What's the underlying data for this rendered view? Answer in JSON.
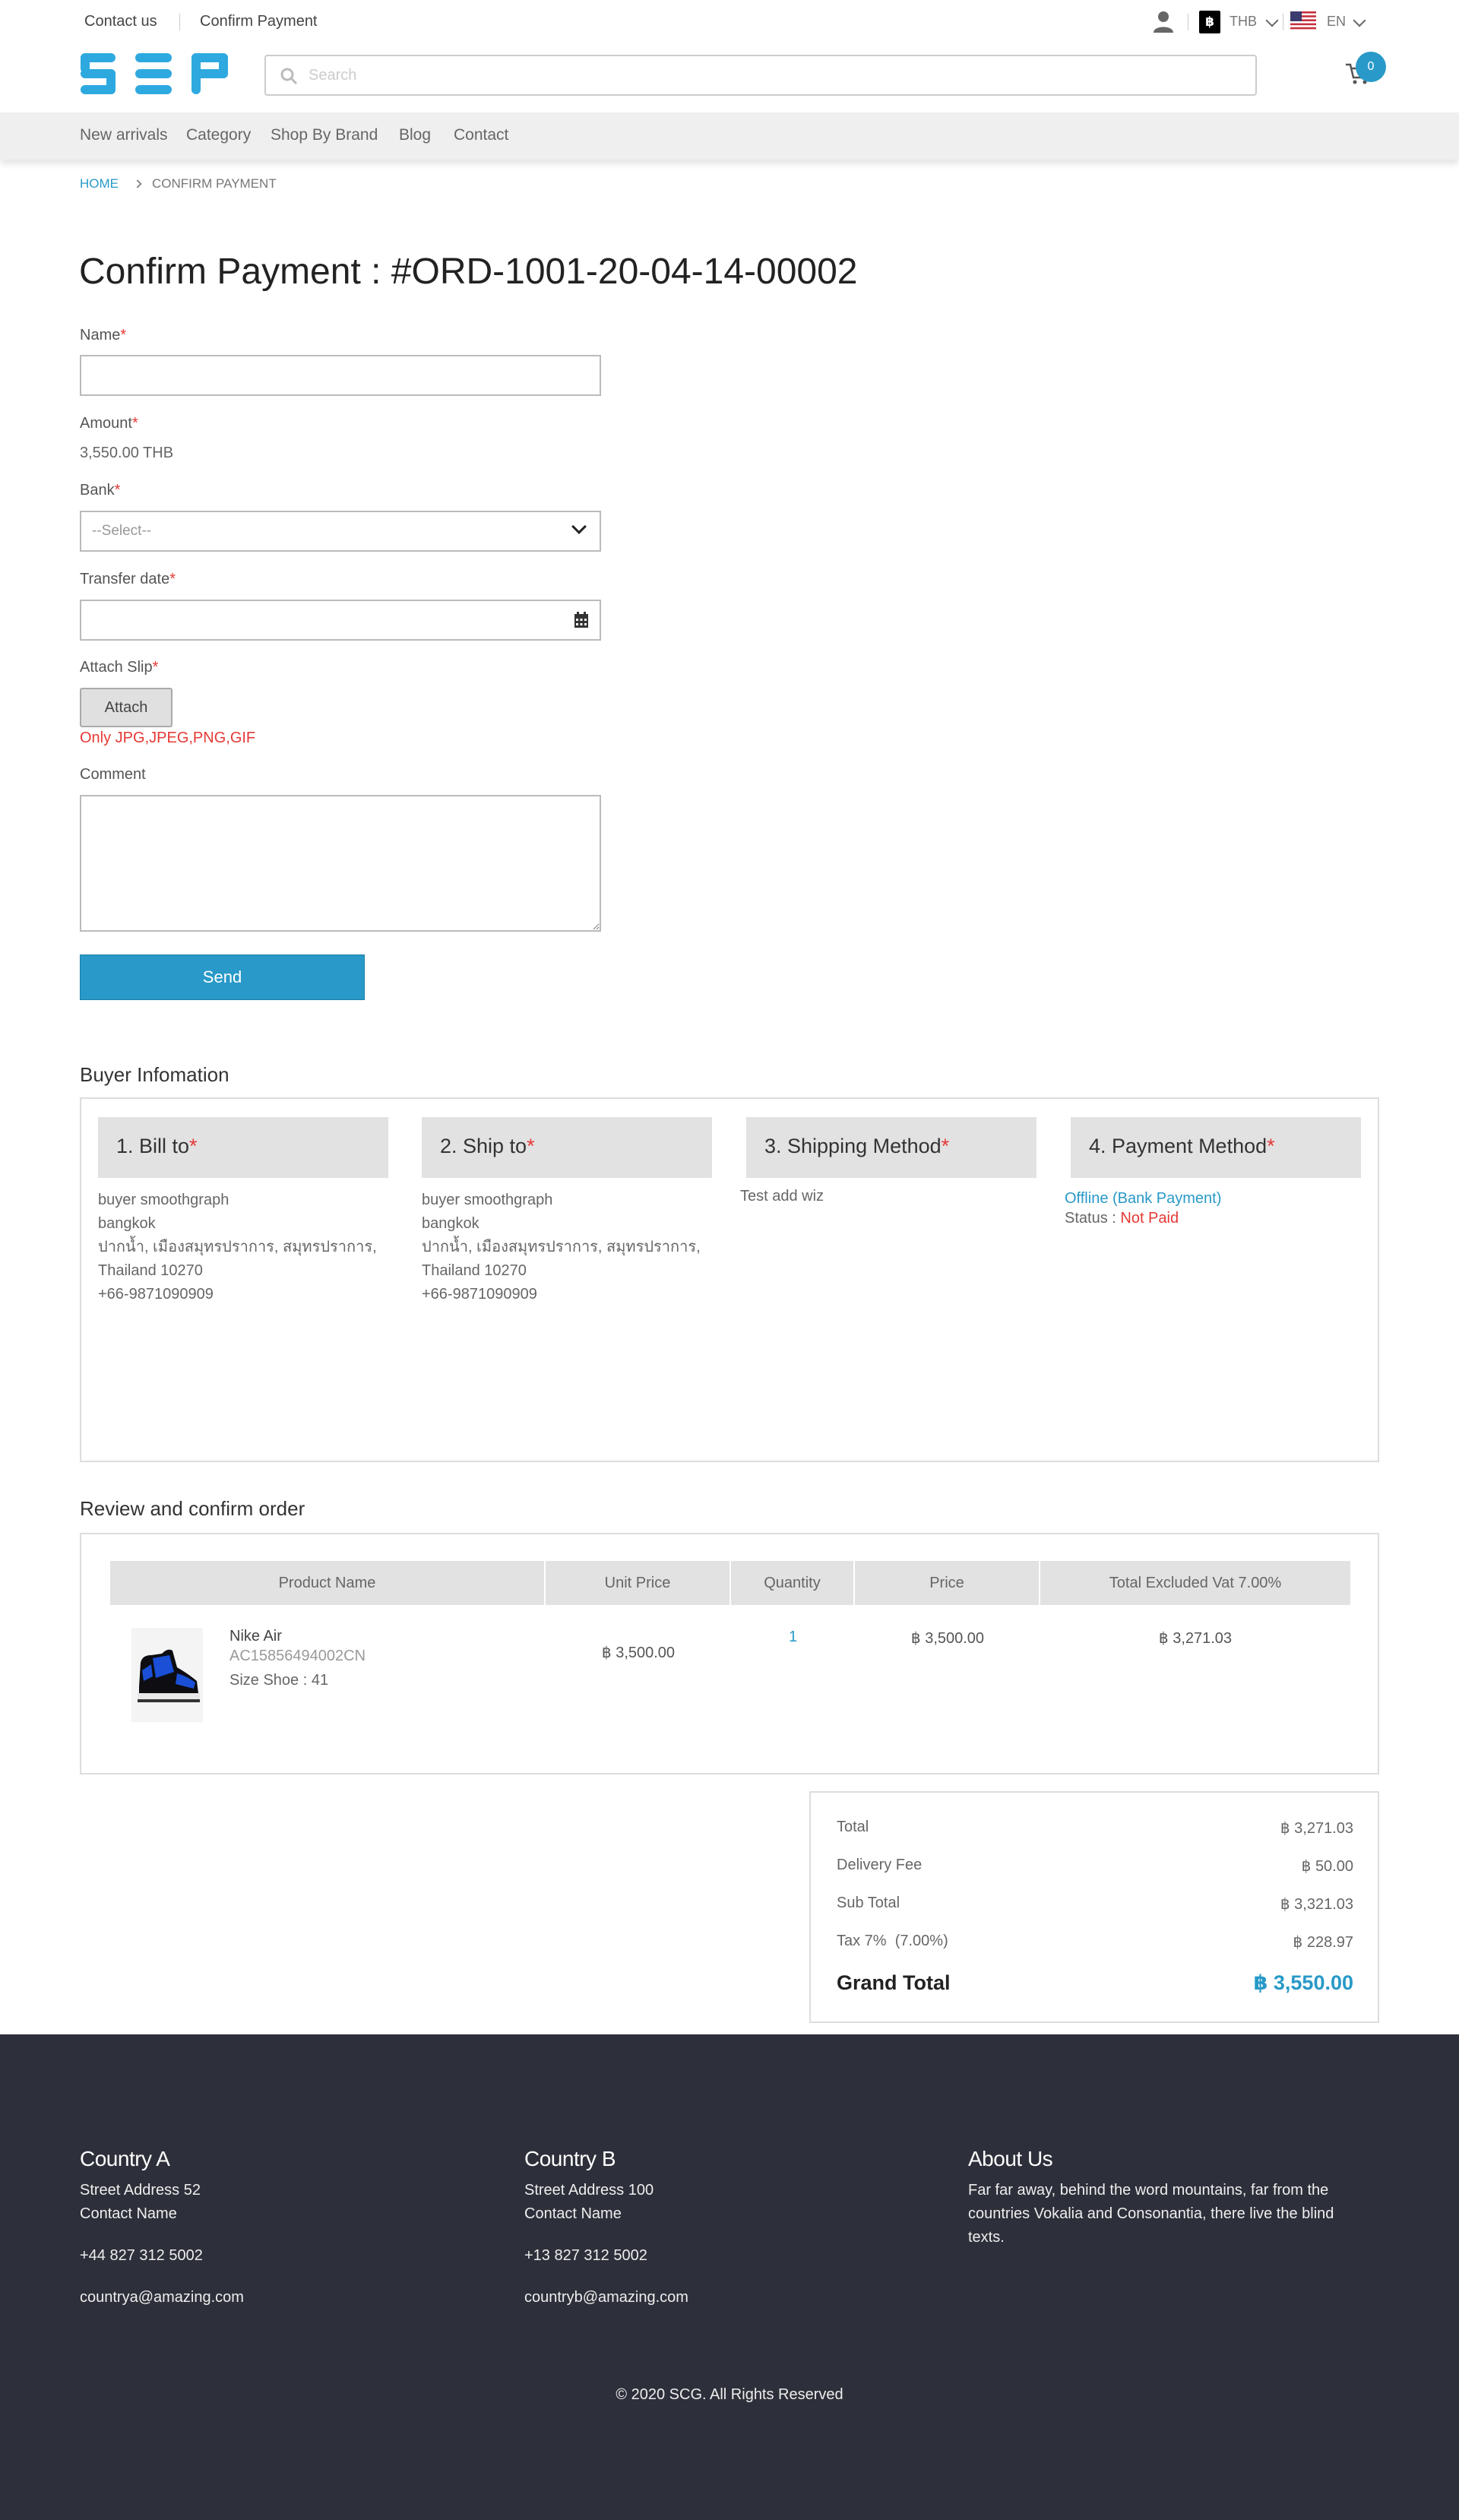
{
  "topbar": {
    "contact_us": "Contact us",
    "confirm_payment": "Confirm Payment",
    "currency_symbol": "฿",
    "currency": "THB",
    "language": "EN",
    "user_icon": "user-icon",
    "flag_icon": "us-flag-icon"
  },
  "header": {
    "logo_text": "SEP",
    "search_placeholder": "Search",
    "cart_count": "0",
    "accent_color": "#2899c8"
  },
  "nav": {
    "items": [
      "New arrivals",
      "Category",
      "Shop By Brand",
      "Blog",
      "Contact"
    ]
  },
  "breadcrumb": {
    "home": "HOME",
    "current": "CONFIRM PAYMENT"
  },
  "page": {
    "title": "Confirm Payment : #ORD-1001-20-04-14-00002"
  },
  "form": {
    "name_label": "Name",
    "amount_label": "Amount",
    "amount_value": "3,550.00 THB",
    "bank_label": "Bank",
    "bank_selected": "--Select--",
    "transfer_date_label": "Transfer date",
    "attach_slip_label": "Attach Slip",
    "attach_button": "Attach",
    "attach_hint": "Only JPG,JPEG,PNG,GIF",
    "comment_label": "Comment",
    "send_button": "Send",
    "required_mark": "*"
  },
  "buyer": {
    "section_title": "Buyer Infomation",
    "bill_to": {
      "heading": "1. Bill to",
      "lines": [
        "buyer smoothgraph",
        "bangkok",
        "ปากน้ำ, เมืองสมุทรปราการ, สมุทรปราการ,",
        "Thailand 10270",
        "+66-9871090909"
      ]
    },
    "ship_to": {
      "heading": "2. Ship to",
      "lines": [
        "buyer smoothgraph",
        "bangkok",
        "ปากน้ำ, เมืองสมุทรปราการ, สมุทรปราการ,",
        "Thailand 10270",
        "+66-9871090909"
      ]
    },
    "shipping_method": {
      "heading": "3. Shipping Method",
      "value": "Test add wiz"
    },
    "payment_method": {
      "heading": "4. Payment Method",
      "value": "Offline (Bank Payment)",
      "status_label": "Status :",
      "status_value": "Not Paid"
    }
  },
  "review": {
    "section_title": "Review and confirm order",
    "columns": [
      "Product Name",
      "Unit Price",
      "Quantity",
      "Price",
      "Total Excluded Vat 7.00%"
    ],
    "rows": [
      {
        "name": "Nike Air",
        "sku": "AC15856494002CN",
        "size": "Size Shoe : 41",
        "unit_price": "฿ 3,500.00",
        "quantity": "1",
        "price": "฿ 3,500.00",
        "total_ex_vat": "฿ 3,271.03"
      }
    ]
  },
  "totals": {
    "rows": [
      {
        "label": "Total",
        "value": "฿ 3,271.03"
      },
      {
        "label": "Delivery Fee",
        "value": "฿ 50.00"
      },
      {
        "label": "Sub Total",
        "value": "฿ 3,321.03"
      },
      {
        "label": "Tax 7%  (7.00%)",
        "value": "฿ 228.97"
      }
    ],
    "grand_label": "Grand Total",
    "grand_value": "฿ 3,550.00"
  },
  "footer": {
    "country_a": {
      "title": "Country A",
      "address": "Street Address 52",
      "contact": "Contact Name",
      "phone": "+44 827 312 5002",
      "email": "countrya@amazing.com"
    },
    "country_b": {
      "title": "Country B",
      "address": "Street Address 100",
      "contact": "Contact Name",
      "phone": "+13 827 312 5002",
      "email": "countryb@amazing.com"
    },
    "about": {
      "title": "About Us",
      "lines": [
        "Far far away, behind the word mountains, far from the",
        "countries Vokalia and Consonantia, there live the blind",
        "texts."
      ]
    },
    "copyright": "© 2020 SCG. All Rights Reserved"
  }
}
